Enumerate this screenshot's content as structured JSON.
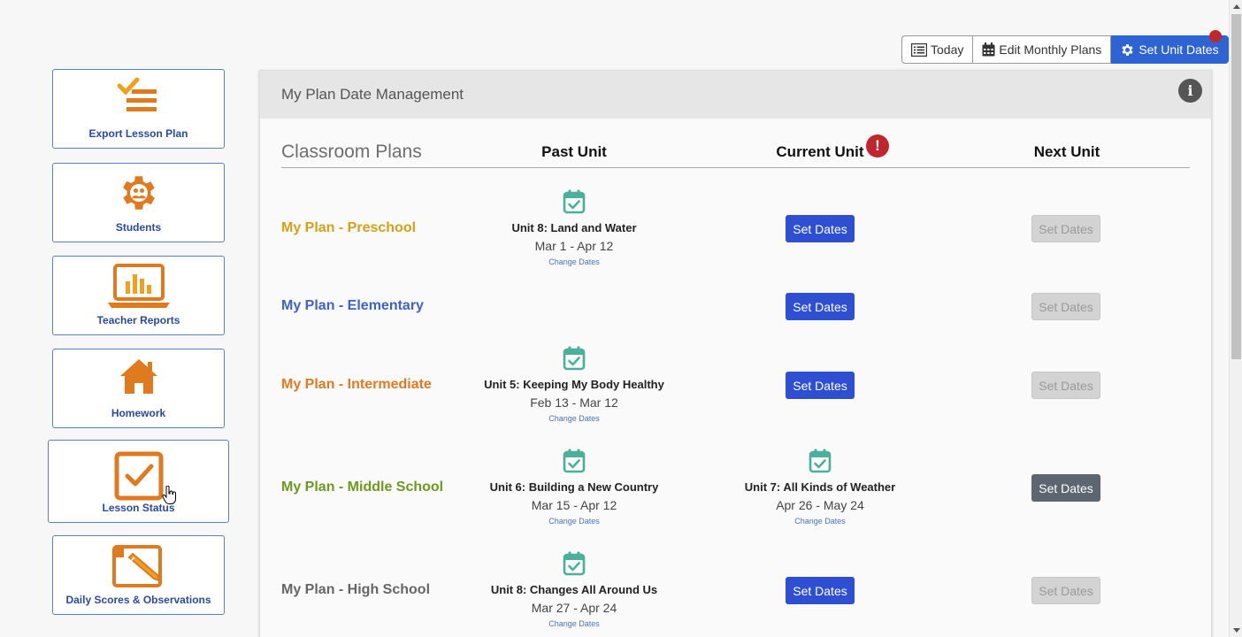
{
  "toolbar": {
    "today": "Today",
    "edit_monthly": "Edit Monthly Plans",
    "set_unit_dates": "Set Unit Dates"
  },
  "sidebar": {
    "items": [
      {
        "label": "Export Lesson Plan",
        "icon": "list-check-icon"
      },
      {
        "label": "Students",
        "icon": "gear-people-icon"
      },
      {
        "label": "Teacher Reports",
        "icon": "laptop-chart-icon"
      },
      {
        "label": "Homework",
        "icon": "house-icon"
      },
      {
        "label": "Lesson Status",
        "icon": "checkbox-icon"
      },
      {
        "label": "Daily Scores & Observations",
        "icon": "clipboard-pencil-icon"
      }
    ]
  },
  "panel": {
    "title": "My Plan Date Management",
    "headers": {
      "classroom": "Classroom Plans",
      "past": "Past Unit",
      "current": "Current Unit",
      "next": "Next Unit"
    },
    "change_dates": "Change Dates",
    "set_dates": "Set Dates",
    "rows": [
      {
        "name": "My Plan - Preschool",
        "color": "#d4a017",
        "past": {
          "title": "Unit 8: Land and Water",
          "dates": "Mar 1 - Apr 12"
        },
        "current": null,
        "next_state": "disabled"
      },
      {
        "name": "My Plan - Elementary",
        "color": "#3f63c4",
        "past": null,
        "current": null,
        "next_state": "disabled"
      },
      {
        "name": "My Plan - Intermediate",
        "color": "#e07a1f",
        "past": {
          "title": "Unit 5: Keeping My Body Healthy",
          "dates": "Feb 13 - Mar 12"
        },
        "current": null,
        "next_state": "disabled"
      },
      {
        "name": "My Plan - Middle School",
        "color": "#6c9a1f",
        "past": {
          "title": "Unit 6: Building a New Country",
          "dates": "Mar 15 - Apr 12"
        },
        "current": {
          "title": "Unit 7: All Kinds of Weather",
          "dates": "Apr 26 - May 24"
        },
        "next_state": "enabled"
      },
      {
        "name": "My Plan - High School",
        "color": "#666666",
        "past": {
          "title": "Unit 8: Changes All Around Us",
          "dates": "Mar 27 - Apr 24"
        },
        "current": null,
        "next_state": "disabled"
      }
    ]
  },
  "colors": {
    "accent_blue": "#2e4fd1",
    "icon_orange": "#e07a1f",
    "calendar_teal": "#4aaf9b",
    "alert_red": "#c0272d"
  }
}
